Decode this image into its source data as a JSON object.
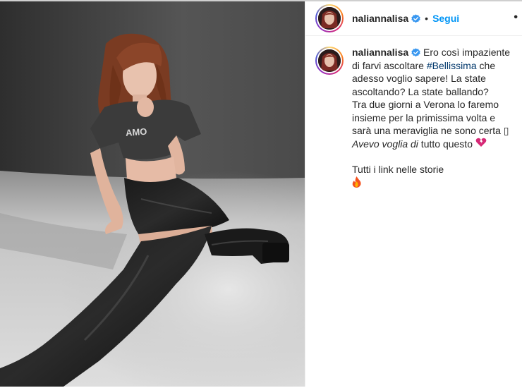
{
  "post": {
    "username": "naliannalisa",
    "follow_label": "Segui",
    "separator": "•",
    "more_label": "•",
    "caption": {
      "intro": "Ero così impaziente di farvi ascoltare ",
      "hashtag": "#Bellissima",
      "after_hashtag": " che adesso voglio sapere! La state ascoltando? La state ballando?",
      "line2_a": "Tra due giorni a Verona lo faremo insieme per la primissima volta e sarà una meraviglia ne sono certa ",
      "line2_box": "▯",
      "line3_italic": "Avevo voglia di",
      "line3_rest": " tutto questo ",
      "line3_emoji": "💔",
      "line4": "Tutti i link nelle storie",
      "line5_emoji": "🔥"
    }
  },
  "colors": {
    "follow": "#0095f6",
    "hashtag": "#00376b",
    "verified": "#3897f0",
    "broken_heart": "#d62976",
    "fire": "#f4511e"
  },
  "icons": {
    "verified": "verified-badge-icon",
    "more": "more-options-icon"
  }
}
